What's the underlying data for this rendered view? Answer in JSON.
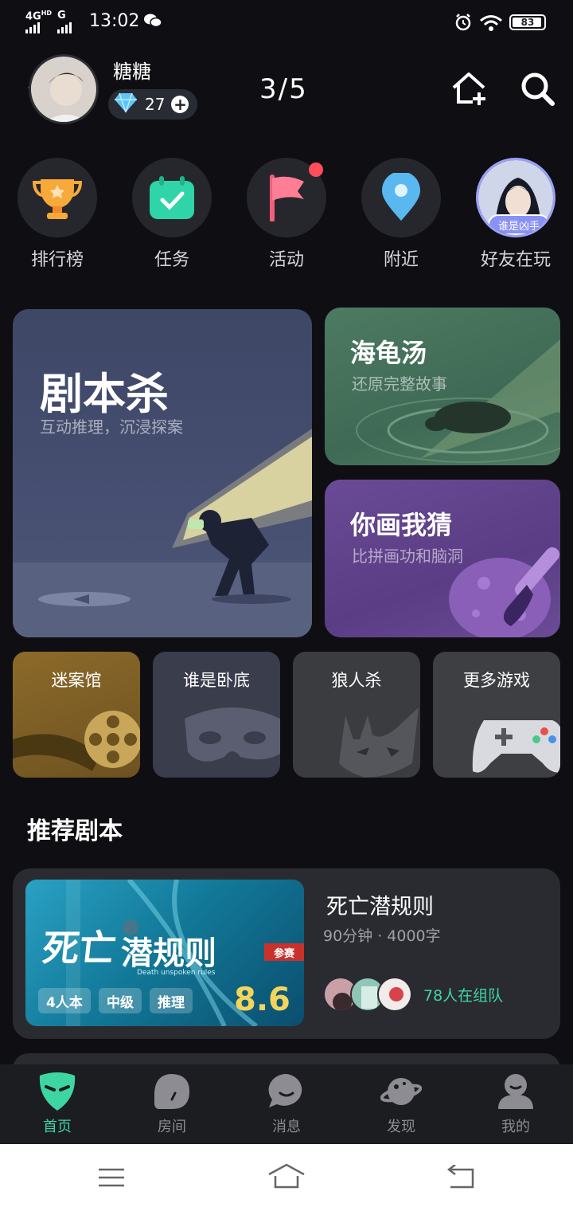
{
  "status_bar": {
    "network": "4G",
    "signal2": "G",
    "time": "13:02",
    "battery": "83"
  },
  "header": {
    "username": "糖糖",
    "gems": "27",
    "counter": "3/5"
  },
  "shortcuts": [
    {
      "label": "排行榜",
      "icon": "trophy-icon"
    },
    {
      "label": "任务",
      "icon": "calendar-check-icon"
    },
    {
      "label": "活动",
      "icon": "flag-icon"
    },
    {
      "label": "附近",
      "icon": "location-pin-icon"
    },
    {
      "label": "好友在玩",
      "icon": "friend-avatar",
      "tag": "谁是凶手"
    }
  ],
  "games": {
    "jubensha": {
      "title": "剧本杀",
      "subtitle": "互动推理，沉浸探案"
    },
    "haiguitang": {
      "title": "海龟汤",
      "subtitle": "还原完整故事"
    },
    "nihuawocai": {
      "title": "你画我猜",
      "subtitle": "比拼画功和脑洞"
    }
  },
  "small_games": [
    {
      "title": "迷案馆"
    },
    {
      "title": "谁是卧底"
    },
    {
      "title": "狼人杀"
    },
    {
      "title": "更多游戏"
    }
  ],
  "section_title": "推荐剧本",
  "recommend": {
    "title": "死亡潜规则",
    "meta": "90分钟 · 4000字",
    "cover_title_1": "死亡",
    "cover_title_2": "潜规则",
    "cover_sub": "Death unspoken rules",
    "contest": "参赛",
    "tags": [
      "4人本",
      "中级",
      "推理"
    ],
    "score": "8.6",
    "team_text": "78人在组队"
  },
  "nav": [
    {
      "label": "首页",
      "active": true
    },
    {
      "label": "房间",
      "active": false
    },
    {
      "label": "消息",
      "active": false
    },
    {
      "label": "发现",
      "active": false
    },
    {
      "label": "我的",
      "active": false
    }
  ],
  "colors": {
    "accent": "#3dd6a3",
    "background": "#0f0f13",
    "card": "#2a2b30",
    "score": "#f4d45b"
  }
}
